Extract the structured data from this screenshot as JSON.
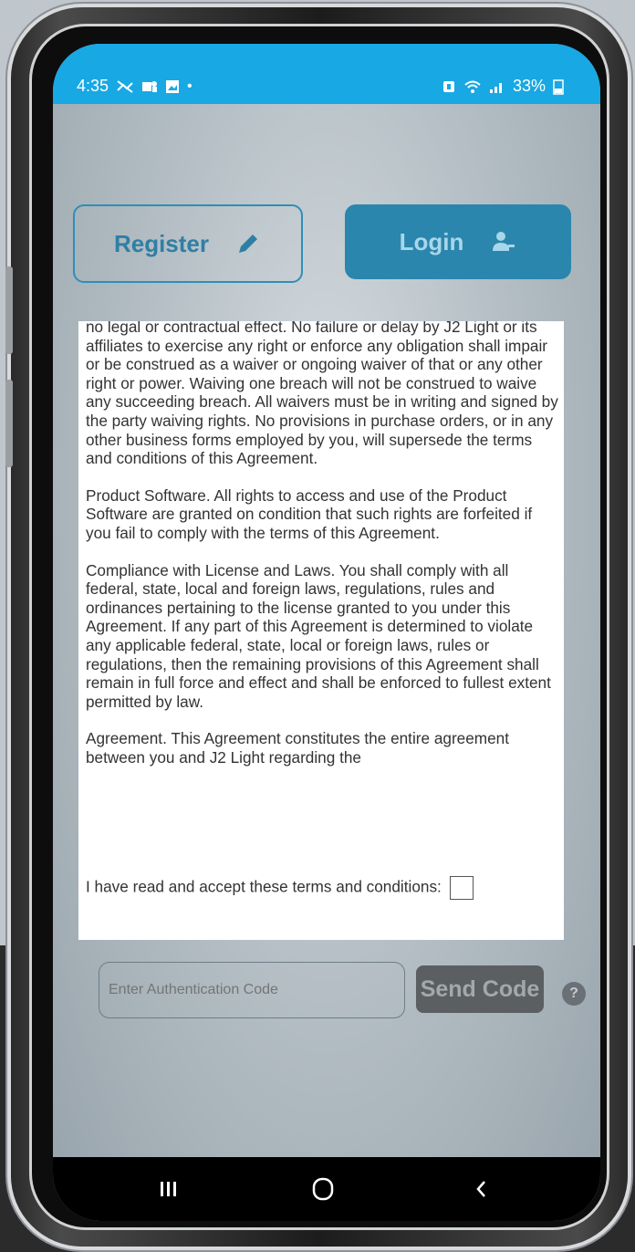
{
  "status": {
    "time": "4:35",
    "battery": "33%"
  },
  "tabs": {
    "register": "Register",
    "login": "Login"
  },
  "terms": {
    "p1": "no legal or contractual effect. No failure or delay by J2 Light or its affiliates to exercise any right or enforce any obligation shall impair or be construed as a waiver or ongoing waiver of that or any other right or power. Waiving one breach will not be construed to waive any succeeding breach. All waivers must be in writing and signed by the party waiving rights. No provisions in purchase orders, or in any other business forms employed by you, will supersede the terms and conditions of this Agreement.",
    "p2": "Product Software. All rights to access and use of the Product Software are granted on condition that such rights are forfeited if you fail to comply with the terms of this Agreement.",
    "p3": "Compliance with License and Laws. You shall comply with all federal, state, local and foreign laws, regulations, rules and ordinances pertaining to the license granted to you under this Agreement. If any part of this Agreement is determined to violate any applicable federal, state, local or foreign laws, rules or regulations, then the remaining provisions of this Agreement shall remain in full force and effect and shall be enforced to fullest extent permitted by law.",
    "p4": "Agreement.  This Agreement constitutes the entire agreement between you and J2 Light regarding the",
    "accept_label": "I have read and accept these terms and conditions:"
  },
  "auth": {
    "placeholder": "Enter Authentication Code",
    "send_code": "Send Code",
    "info": "?"
  },
  "icons": {
    "register": "pencil-icon",
    "login": "user-icon"
  }
}
